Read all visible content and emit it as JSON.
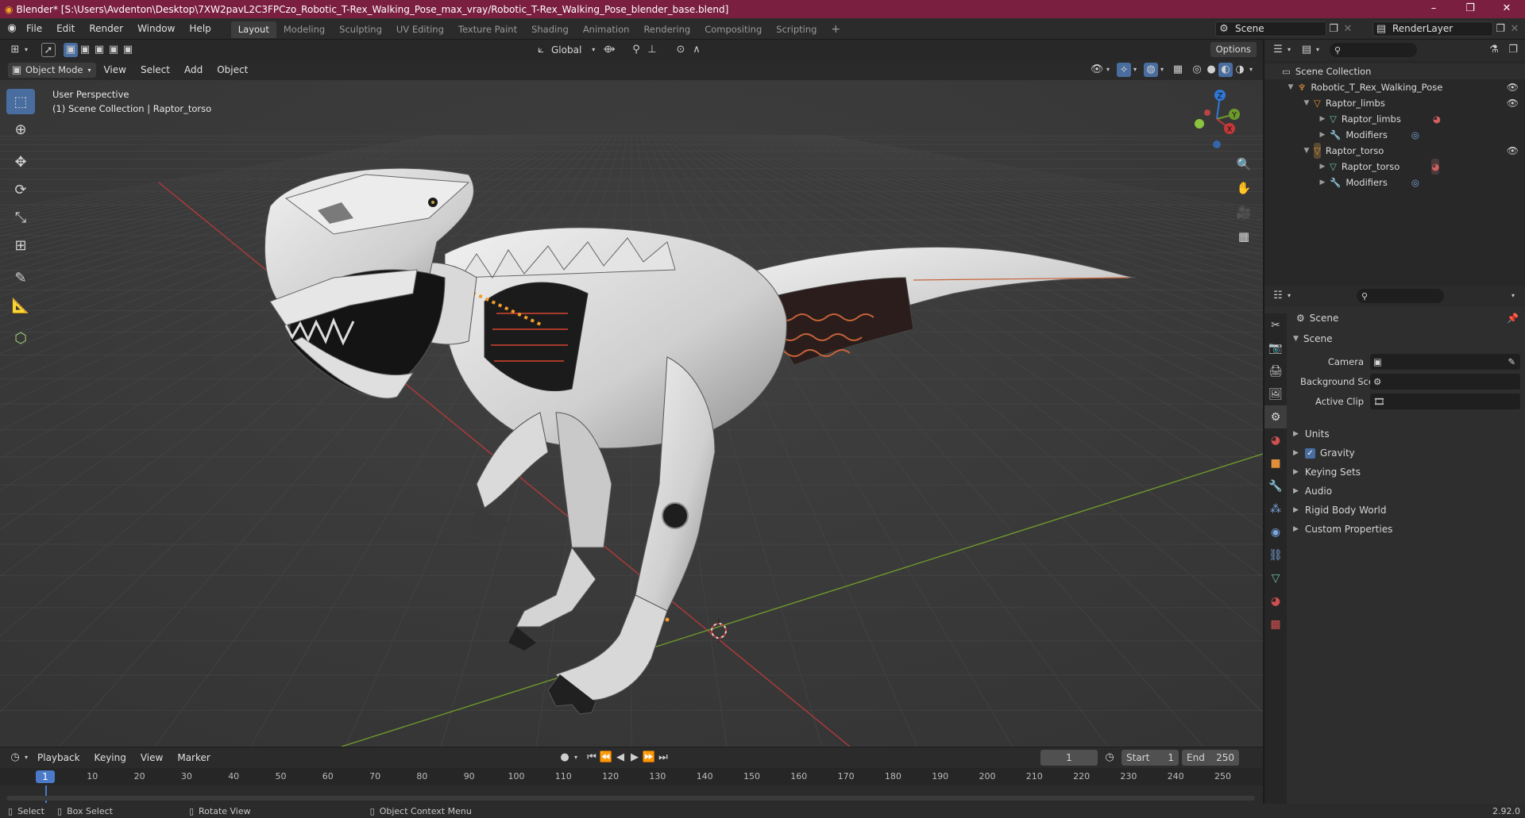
{
  "window": {
    "title": "Blender* [S:\\Users\\Avdenton\\Desktop\\7XW2pavL2C3FPCzo_Robotic_T-Rex_Walking_Pose_max_vray/Robotic_T-Rex_Walking_Pose_blender_base.blend]",
    "controls": [
      "–",
      "❐",
      "✕"
    ]
  },
  "menu": [
    "File",
    "Edit",
    "Render",
    "Window",
    "Help"
  ],
  "workspaces": [
    "Layout",
    "Modeling",
    "Sculpting",
    "UV Editing",
    "Texture Paint",
    "Shading",
    "Animation",
    "Rendering",
    "Compositing",
    "Scripting"
  ],
  "active_workspace": "Layout",
  "scene_selector": "Scene",
  "view_layer": "RenderLayer",
  "viewport": {
    "mode": "Object Mode",
    "menus": [
      "View",
      "Select",
      "Add",
      "Object"
    ],
    "orientation": "Global",
    "options_label": "Options",
    "info_line1": "User Perspective",
    "info_line2": "(1) Scene Collection | Raptor_torso",
    "axis_labels": {
      "z": "Z",
      "y": "Y",
      "x": "X"
    }
  },
  "outliner": {
    "root": "Scene Collection",
    "items": [
      {
        "label": "Robotic_T_Rex_Walking_Pose",
        "depth": 1,
        "type": "armature"
      },
      {
        "label": "Raptor_limbs",
        "depth": 2,
        "type": "object"
      },
      {
        "label": "Raptor_limbs",
        "depth": 3,
        "type": "mesh"
      },
      {
        "label": "Modifiers",
        "depth": 3,
        "type": "modifiers"
      },
      {
        "label": "Raptor_torso",
        "depth": 2,
        "type": "object"
      },
      {
        "label": "Raptor_torso",
        "depth": 3,
        "type": "mesh"
      },
      {
        "label": "Modifiers",
        "depth": 3,
        "type": "modifiers"
      }
    ]
  },
  "properties": {
    "context": "Scene",
    "panel": "Scene",
    "fields": [
      {
        "label": "Camera",
        "value": ""
      },
      {
        "label": "Background Scene",
        "value": ""
      },
      {
        "label": "Active Clip",
        "value": ""
      }
    ],
    "sections": [
      "Units",
      "Gravity",
      "Keying Sets",
      "Audio",
      "Rigid Body World",
      "Custom Properties"
    ],
    "gravity_checked": true
  },
  "timeline": {
    "menus": [
      "Playback",
      "Keying",
      "View",
      "Marker"
    ],
    "current_frame": "1",
    "start_label": "Start",
    "start": "1",
    "end_label": "End",
    "end": "250",
    "ruler": [
      "10",
      "20",
      "30",
      "40",
      "50",
      "60",
      "70",
      "80",
      "90",
      "100",
      "110",
      "120",
      "130",
      "140",
      "150",
      "160",
      "170",
      "180",
      "190",
      "200",
      "210",
      "220",
      "230",
      "240",
      "250"
    ],
    "playhead": "1"
  },
  "statusbar": {
    "select": "Select",
    "box_select": "Box Select",
    "rotate": "Rotate View",
    "context_menu": "Object Context Menu",
    "version": "2.92.0"
  },
  "colors": {
    "titlebar": "#7a1f3f",
    "accent": "#4a6da0",
    "x_axis": "#c43838",
    "y_axis": "#6e9a2c",
    "z_axis": "#2f78d8"
  }
}
